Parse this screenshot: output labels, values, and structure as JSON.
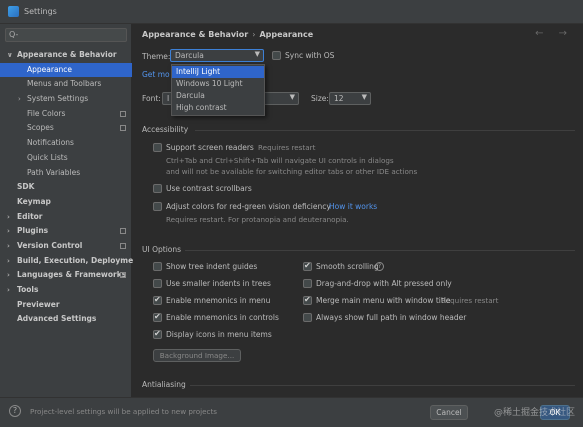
{
  "window": {
    "title": "Settings"
  },
  "search": {
    "glyph": "Q-"
  },
  "sidebar": {
    "items": [
      {
        "label": "Appearance & Behavior",
        "arrow": "∨",
        "bold": true
      },
      {
        "label": "Appearance",
        "selected": true
      },
      {
        "label": "Menus and Toolbars"
      },
      {
        "label": "System Settings",
        "arrow": "›"
      },
      {
        "label": "File Colors",
        "mark": true
      },
      {
        "label": "Scopes",
        "mark": true
      },
      {
        "label": "Notifications"
      },
      {
        "label": "Quick Lists"
      },
      {
        "label": "Path Variables"
      },
      {
        "label": "SDK",
        "bold": true
      },
      {
        "label": "Keymap",
        "bold": true
      },
      {
        "label": "Editor",
        "arrow": "›",
        "bold": true
      },
      {
        "label": "Plugins",
        "arrow": "›",
        "bold": true,
        "mark": true
      },
      {
        "label": "Version Control",
        "arrow": "›",
        "bold": true,
        "mark": true
      },
      {
        "label": "Build, Execution, Deployment",
        "arrow": "›",
        "bold": true
      },
      {
        "label": "Languages & Frameworks",
        "arrow": "›",
        "bold": true,
        "mark": true
      },
      {
        "label": "Tools",
        "arrow": "›",
        "bold": true
      },
      {
        "label": "Previewer",
        "bold": true
      },
      {
        "label": "Advanced Settings",
        "bold": true
      }
    ]
  },
  "breadcrumb": {
    "parent": "Appearance & Behavior",
    "separator": "›",
    "current": "Appearance"
  },
  "nav": {
    "arrows": "← →"
  },
  "theme": {
    "label": "Theme:",
    "value": "Darcula",
    "sync_label": "Sync with OS",
    "options": [
      "IntelliJ Light",
      "Windows 10 Light",
      "Darcula",
      "High contrast"
    ],
    "highlighted": "IntelliJ Light",
    "get_more": "Get mo"
  },
  "font": {
    "label": "Font:",
    "value": "I",
    "size_label": "Size:",
    "size_value": "12"
  },
  "accessibility": {
    "title": "Accessibility",
    "screen_readers": "Support screen readers",
    "screen_readers_hint": "Requires restart",
    "screen_readers_desc1": "Ctrl+Tab and Ctrl+Shift+Tab will navigate UI controls in dialogs",
    "screen_readers_desc2": "and will not be available for switching editor tabs or other IDE actions",
    "contrast_scrollbars": "Use contrast scrollbars",
    "red_green": "Adjust colors for red-green vision deficiency",
    "red_green_link": "How it works",
    "red_green_hint": "Requires restart. For protanopia and deuteranopia."
  },
  "ui_options": {
    "title": "UI Options",
    "left": [
      {
        "label": "Show tree indent guides",
        "checked": false
      },
      {
        "label": "Use smaller indents in trees",
        "checked": false
      },
      {
        "label": "Enable mnemonics in menu",
        "checked": true
      },
      {
        "label": "Enable mnemonics in controls",
        "checked": true
      },
      {
        "label": "Display icons in menu items",
        "checked": true
      }
    ],
    "right": [
      {
        "label": "Smooth scrolling",
        "checked": true
      },
      {
        "label": "Drag-and-drop with Alt pressed only",
        "checked": false
      },
      {
        "label": "Merge main menu with window title",
        "checked": true
      },
      {
        "label": "Always show full path in window header",
        "checked": false
      }
    ],
    "merge_hint": "Requires restart",
    "info_glyph": "?",
    "background_image": "Background Image..."
  },
  "antialiasing": {
    "title": "Antialiasing"
  },
  "footer": {
    "help": "?",
    "note": "Project-level settings will be applied to new projects",
    "cancel": "Cancel",
    "ok": "OK",
    "watermark": "@稀土掘金技术社区"
  },
  "colors": {
    "accent": "#2f65ca",
    "link": "#5394ec",
    "background": "#2b2b2b",
    "panel": "#3c3f41"
  }
}
